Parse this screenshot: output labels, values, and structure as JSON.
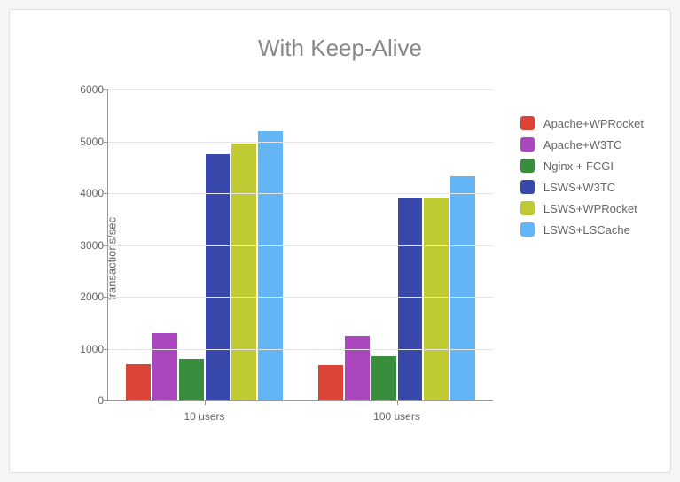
{
  "chart_data": {
    "type": "bar",
    "title": "With Keep-Alive",
    "ylabel": "transactions/sec",
    "xlabel": "",
    "ylim": [
      0,
      6000
    ],
    "yticks": [
      0,
      1000,
      2000,
      3000,
      4000,
      5000,
      6000
    ],
    "categories": [
      "10 users",
      "100 users"
    ],
    "series": [
      {
        "name": "Apache+WPRocket",
        "color": "#db4437",
        "values": [
          700,
          680
        ]
      },
      {
        "name": "Apache+W3TC",
        "color": "#ab47bc",
        "values": [
          1300,
          1250
        ]
      },
      {
        "name": "Nginx + FCGI",
        "color": "#388e3c",
        "values": [
          800,
          850
        ]
      },
      {
        "name": "LSWS+W3TC",
        "color": "#3949ab",
        "values": [
          4750,
          3900
        ]
      },
      {
        "name": "LSWS+WPRocket",
        "color": "#c0ca33",
        "values": [
          4950,
          3900
        ]
      },
      {
        "name": "LSWS+LSCache",
        "color": "#64b5f6",
        "values": [
          5200,
          4320
        ]
      }
    ]
  }
}
